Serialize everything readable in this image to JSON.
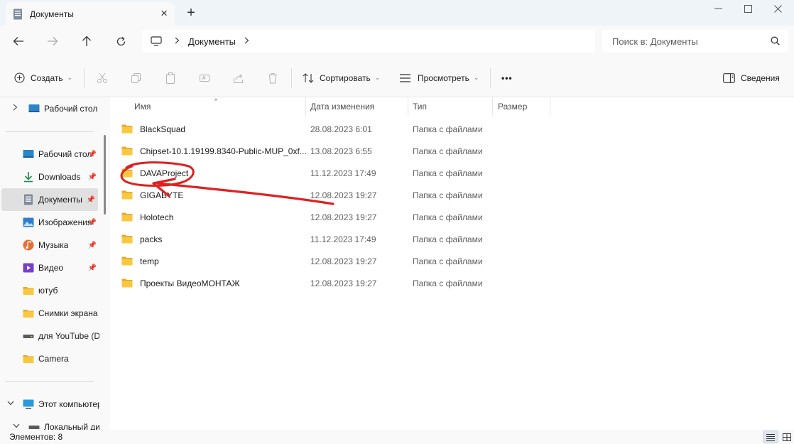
{
  "window": {
    "tab_title": "Документы",
    "tab_icon": "documents-icon"
  },
  "addressbar": {
    "crumbs": [
      "Документы"
    ],
    "search_placeholder": "Поиск в: Документы"
  },
  "commandbar": {
    "create_label": "Создать",
    "sort_label": "Сортировать",
    "view_label": "Просмотреть",
    "more_label": "•••",
    "details_label": "Сведения"
  },
  "sidebar": {
    "top_item": "Рабочий стол",
    "items": [
      {
        "label": "Рабочий стол",
        "icon": "desktop-icon",
        "pinned": true
      },
      {
        "label": "Downloads",
        "icon": "download-icon",
        "pinned": true
      },
      {
        "label": "Документы",
        "icon": "documents-icon",
        "pinned": true,
        "selected": true
      },
      {
        "label": "Изображения",
        "icon": "pictures-icon",
        "pinned": true
      },
      {
        "label": "Музыка",
        "icon": "music-icon",
        "pinned": true
      },
      {
        "label": "Видео",
        "icon": "video-icon",
        "pinned": true
      },
      {
        "label": "ютуб",
        "icon": "folder-icon",
        "pinned": false
      },
      {
        "label": "Снимки экрана",
        "icon": "folder-icon",
        "pinned": false
      },
      {
        "label": "для YouTube (D:)",
        "icon": "drive-icon",
        "pinned": false
      },
      {
        "label": "Camera",
        "icon": "folder-icon",
        "pinned": false
      }
    ],
    "this_pc": "Этот компьютер",
    "local_disk": "Локальный диск"
  },
  "columns": {
    "name": "Имя",
    "date": "Дата изменения",
    "type": "Тип",
    "size": "Размер"
  },
  "files": [
    {
      "name": "BlackSquad",
      "date": "28.08.2023 6:01",
      "type": "Папка с файлами"
    },
    {
      "name": "Chipset-10.1.19199.8340-Public-MUP_0xf...",
      "date": "13.08.2023 6:55",
      "type": "Папка с файлами"
    },
    {
      "name": "DAVAProject",
      "date": "11.12.2023 17:49",
      "type": "Папка с файлами"
    },
    {
      "name": "GIGABYTE",
      "date": "12.08.2023 19:27",
      "type": "Папка с файлами"
    },
    {
      "name": "Holotech",
      "date": "12.08.2023 19:27",
      "type": "Папка с файлами"
    },
    {
      "name": "packs",
      "date": "11.12.2023 17:49",
      "type": "Папка с файлами"
    },
    {
      "name": "temp",
      "date": "12.08.2023 19:27",
      "type": "Папка с файлами"
    },
    {
      "name": "Проекты ВидеоМОНТАЖ",
      "date": "12.08.2023 19:27",
      "type": "Папка с файлами"
    }
  ],
  "status": {
    "count": "Элементов: 8"
  },
  "colors": {
    "folder": "#f8c940",
    "folder_dark": "#e8a92a",
    "annotation": "#e02020",
    "accent": "#0067c0"
  }
}
